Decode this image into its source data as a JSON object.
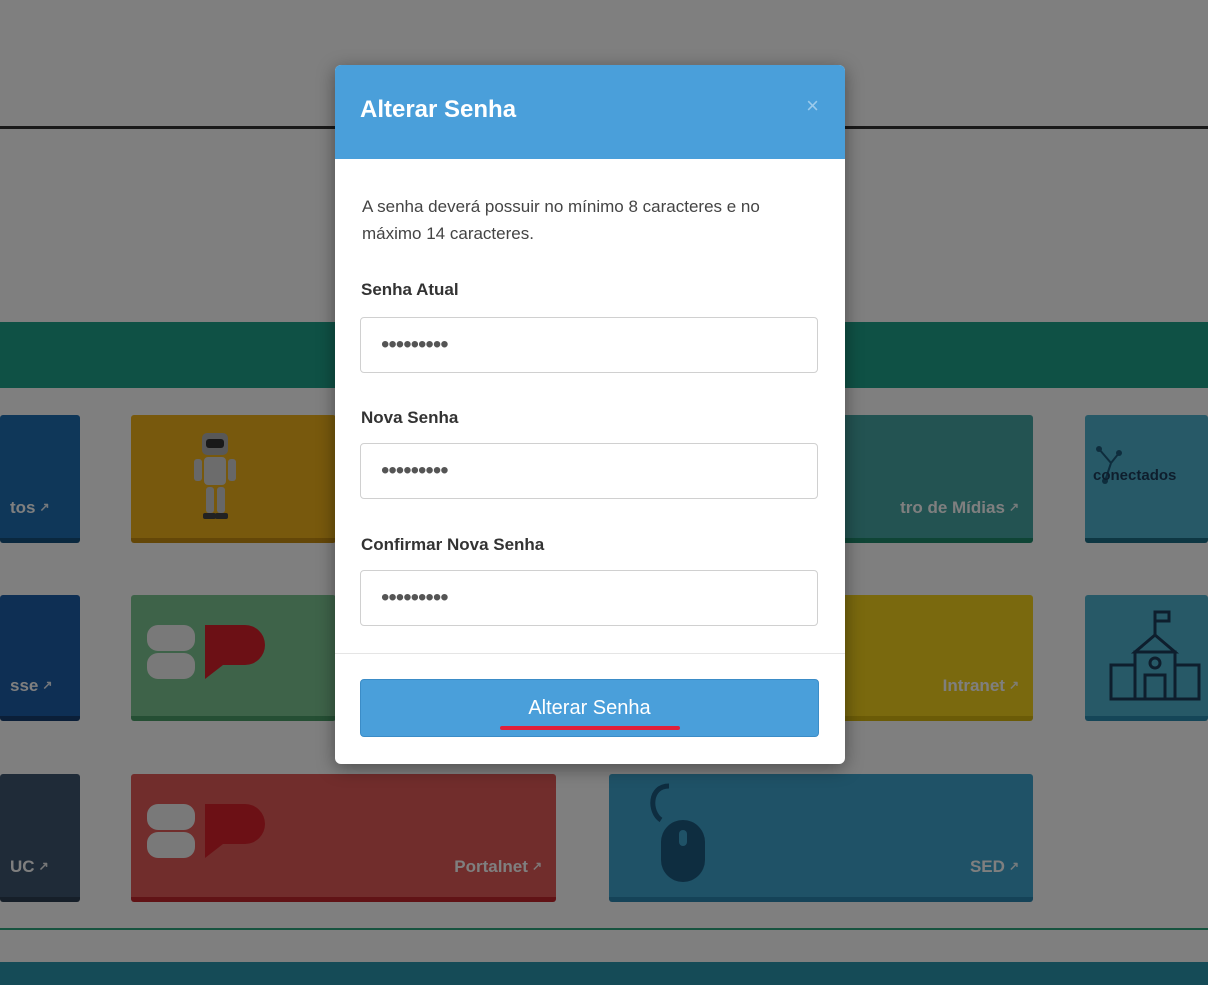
{
  "background": {
    "tiles": [
      {
        "id": "t1",
        "label": "tos",
        "color": "#1f6fb3",
        "accent": "#15507f"
      },
      {
        "id": "t2",
        "label": "",
        "color": "#f0b21a",
        "accent": "#c98e10"
      },
      {
        "id": "t3",
        "label": "tro de Mídias",
        "color": "#46a6a4",
        "accent": "#1f8a6d"
      },
      {
        "id": "t4",
        "label": "",
        "color": "#4fb3cf",
        "accent": "#1d6f86"
      },
      {
        "id": "t5",
        "label": "sse",
        "color": "#1d5ea8",
        "accent": "#163f70"
      },
      {
        "id": "t6",
        "label": "",
        "color": "#7cc693",
        "accent": "#4a9e68"
      },
      {
        "id": "t7",
        "label": "Intranet",
        "color": "#f5d21c",
        "accent": "#d6b70f"
      },
      {
        "id": "t8",
        "label": "",
        "color": "#4fb3cf",
        "accent": "#2a8cb0"
      },
      {
        "id": "t9",
        "label": "UC",
        "color": "#3e5770",
        "accent": "#2c3f52"
      },
      {
        "id": "t10",
        "label": "Portalnet",
        "color": "#e35b58",
        "accent": "#c3262d"
      },
      {
        "id": "t11",
        "label": "SED",
        "color": "#3fa4cf",
        "accent": "#2a86b0"
      }
    ],
    "conectados_text": "conectados"
  },
  "modal": {
    "title": "Alterar Senha",
    "close_symbol": "×",
    "help_text": "A senha deverá possuir no mínimo 8 caracteres e no máximo 14 caracteres.",
    "fields": [
      {
        "label": "Senha Atual",
        "value": "•••••••••"
      },
      {
        "label": "Nova Senha",
        "value": "•••••••••"
      },
      {
        "label": "Confirmar Nova Senha",
        "value": "•••••••••"
      }
    ],
    "submit_label": "Alterar Senha"
  },
  "colors": {
    "header": "#4a9fda",
    "button": "#4a9fda",
    "underline": "#e0203a"
  }
}
